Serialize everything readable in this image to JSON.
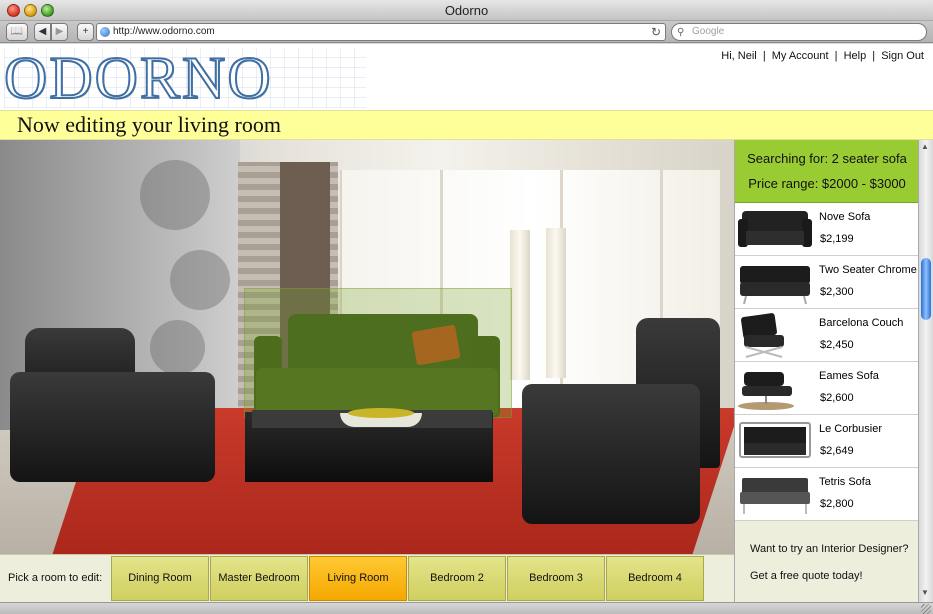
{
  "window": {
    "title": "Odorno"
  },
  "browser": {
    "url": "http://www.odorno.com",
    "search_placeholder": "Google"
  },
  "site": {
    "logo": "ODORNO",
    "nav": {
      "greeting": "Hi, Neil",
      "account": "My Account",
      "help": "Help",
      "signout": "Sign Out",
      "separator": "|"
    },
    "banner": "Now editing your living room"
  },
  "search_summary": {
    "query": "Searching for: 2 seater sofa",
    "price_range": "Price range: $2000 - $3000"
  },
  "products": [
    {
      "name": "Nove Sofa",
      "price": "$2,199"
    },
    {
      "name": "Two Seater Chrome",
      "price": "$2,300"
    },
    {
      "name": "Barcelona Couch",
      "price": "$2,450"
    },
    {
      "name": "Eames Sofa",
      "price": "$2,600"
    },
    {
      "name": "Le Corbusier",
      "price": "$2,649"
    },
    {
      "name": "Tetris Sofa",
      "price": "$2,800"
    }
  ],
  "designer_promo": {
    "line1": "Want to try an Interior Designer?",
    "line2": "Get a free quote today!"
  },
  "rooms": {
    "label": "Pick a room to edit:",
    "tabs": [
      "Dining Room",
      "Master Bedroom",
      "Living Room",
      "Bedroom 2",
      "Bedroom 3",
      "Bedroom 4"
    ],
    "active": "Living Room"
  },
  "colors": {
    "banner": "#ffff99",
    "search_summary": "#99cc33",
    "active_tab": "#f5a800",
    "tab": "#d9d970"
  }
}
